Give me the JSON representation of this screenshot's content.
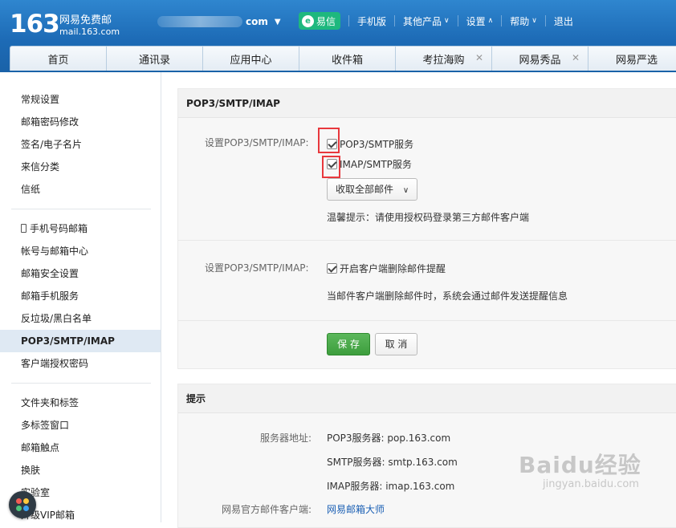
{
  "header": {
    "logo_number": "163",
    "logo_cn": "网易免费邮",
    "logo_en": "mail.163.com",
    "account_suffix": "com",
    "nav": {
      "yixin": "易信",
      "mobile": "手机版",
      "other_products": "其他产品",
      "settings": "设置",
      "help": "帮助",
      "logout": "退出"
    },
    "tabs": [
      {
        "label": "首页"
      },
      {
        "label": "通讯录"
      },
      {
        "label": "应用中心"
      },
      {
        "label": "收件箱"
      },
      {
        "label": "考拉海购"
      },
      {
        "label": "网易秀品"
      },
      {
        "label": "网易严选"
      }
    ]
  },
  "sidebar": {
    "group1": [
      "常规设置",
      "邮箱密码修改",
      "签名/电子名片",
      "来信分类",
      "信纸"
    ],
    "group2": [
      "手机号码邮箱",
      "帐号与邮箱中心",
      "邮箱安全设置",
      "邮箱手机服务",
      "反垃圾/黑白名单",
      "POP3/SMTP/IMAP",
      "客户端授权密码"
    ],
    "group3": [
      "文件夹和标签",
      "多标签窗口",
      "邮箱触点",
      "换肤",
      "实验室",
      "升级VIP邮箱"
    ],
    "active": "POP3/SMTP/IMAP"
  },
  "main": {
    "section_title": "POP3/SMTP/IMAP",
    "setting_label_1": "设置POP3/SMTP/IMAP:",
    "pop3_service": "POP3/SMTP服务",
    "imap_service": "IMAP/SMTP服务",
    "receive_select": "收取全部邮件",
    "hint": "温馨提示：请使用授权码登录第三方邮件客户端",
    "setting_label_2": "设置POP3/SMTP/IMAP:",
    "delete_reminder": "开启客户端删除邮件提醒",
    "delete_reminder_desc": "当邮件客户端删除邮件时，系统会通过邮件发送提醒信息",
    "save": "保 存",
    "cancel": "取 消"
  },
  "tips": {
    "title": "提示",
    "server_label": "服务器地址:",
    "pop3": "POP3服务器: pop.163.com",
    "smtp": "SMTP服务器: smtp.163.com",
    "imap": "IMAP服务器: imap.163.com",
    "client_label": "网易官方邮件客户端:",
    "client_link": "网易邮箱大师"
  },
  "watermark": {
    "main": "Baidu经验",
    "sub": "jingyan.baidu.com"
  }
}
